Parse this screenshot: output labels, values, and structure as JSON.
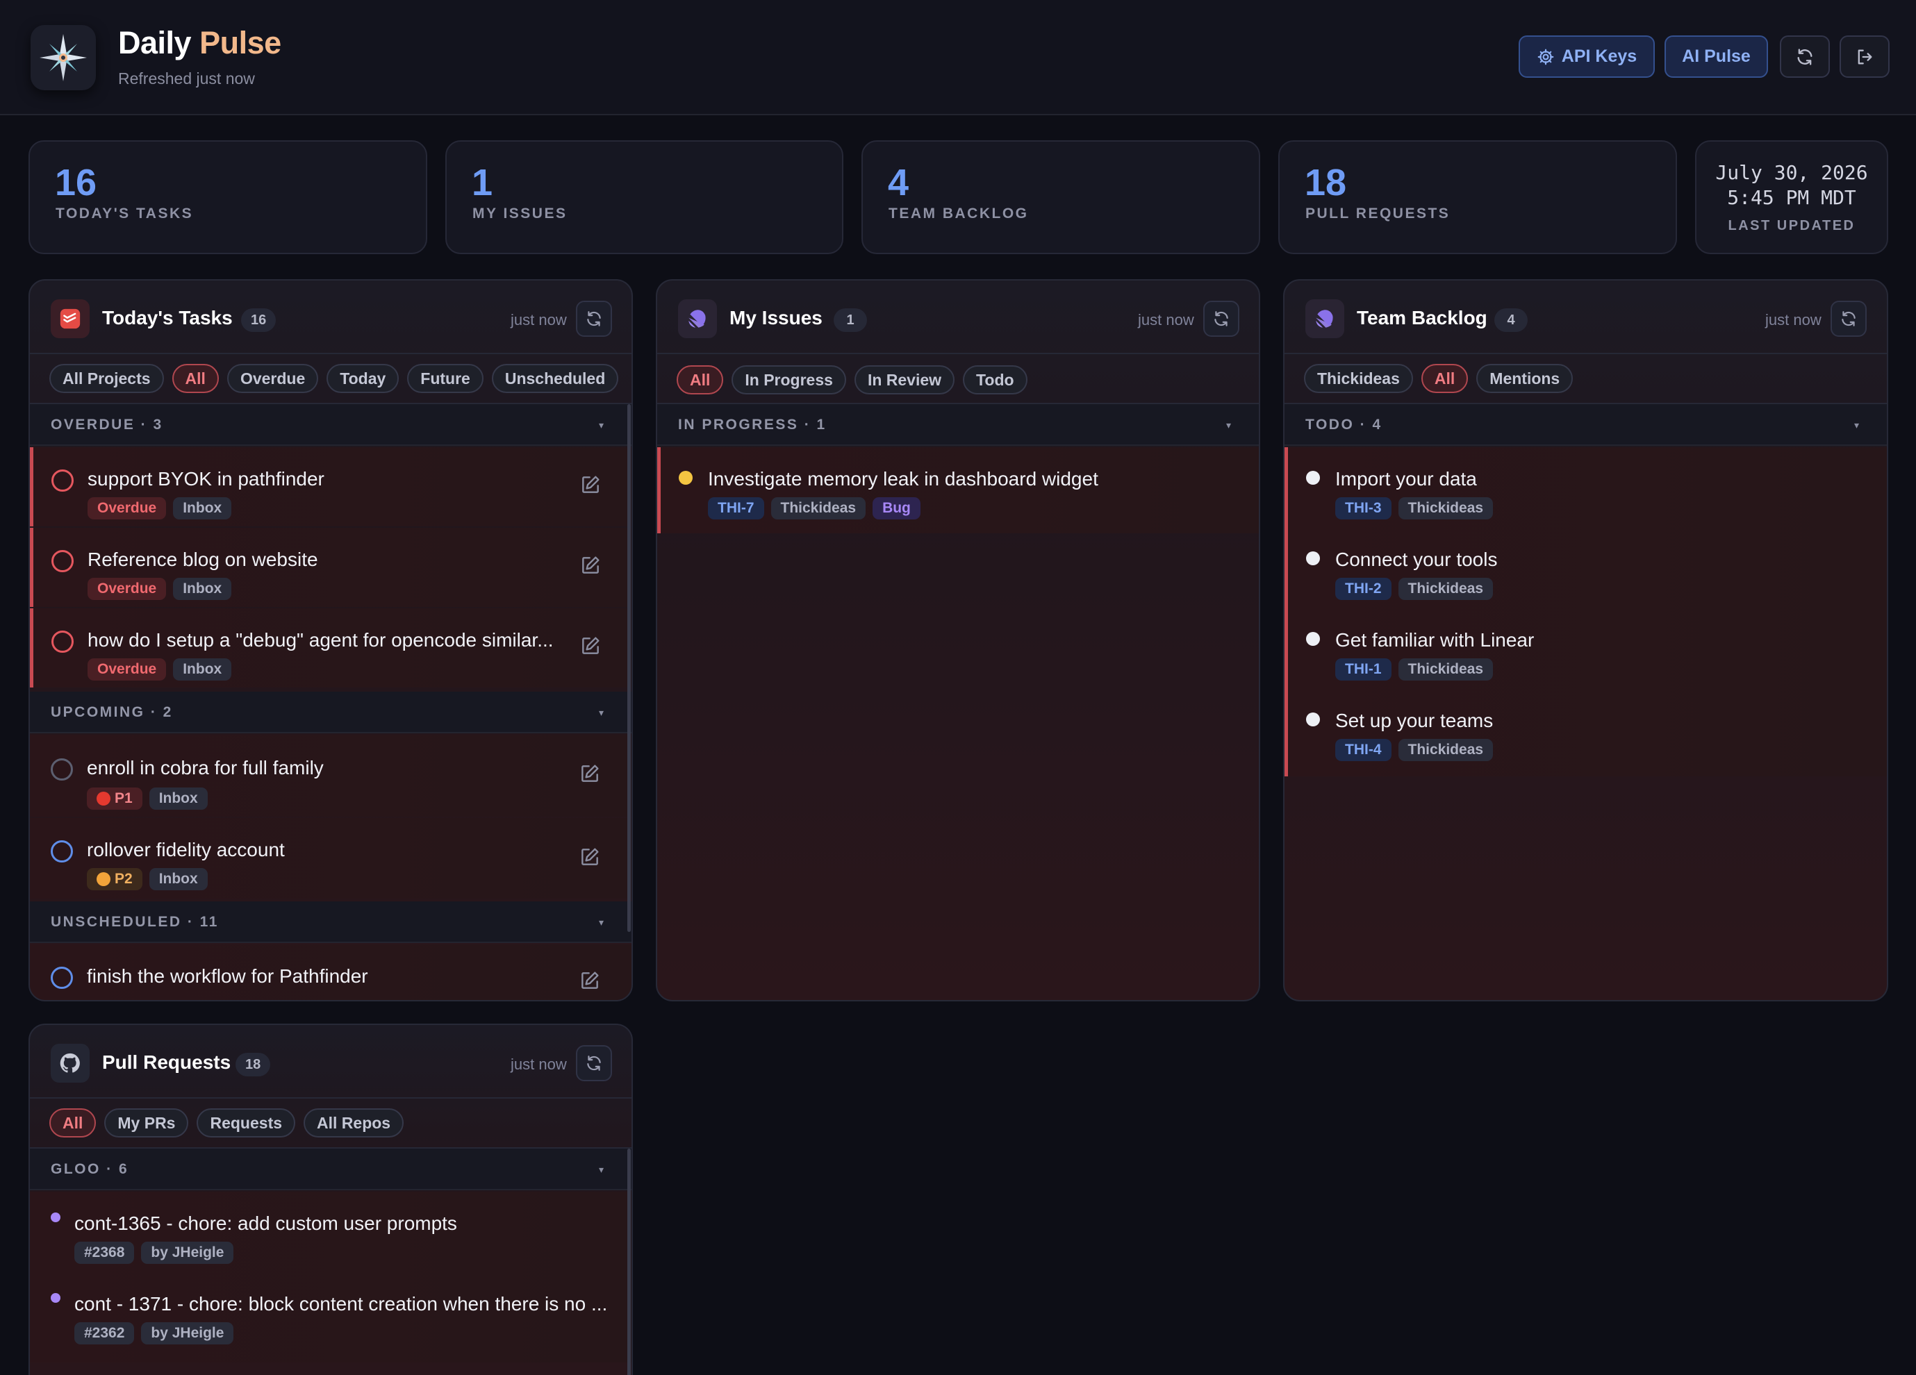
{
  "app": {
    "title_part1": "Daily",
    "title_part2": "Pulse",
    "subtitle": "Refreshed just now"
  },
  "header_buttons": {
    "api_keys": "API Keys",
    "ai_pulse": "AI Pulse"
  },
  "stats": [
    {
      "value": "16",
      "label": "TODAY'S TASKS"
    },
    {
      "value": "1",
      "label": "MY ISSUES"
    },
    {
      "value": "4",
      "label": "TEAM BACKLOG"
    },
    {
      "value": "18",
      "label": "PULL REQUESTS"
    }
  ],
  "last_updated": {
    "date": "July 30, 2026",
    "time": "5:45 PM MDT",
    "label": "LAST UPDATED"
  },
  "tasks": {
    "title": "Today's Tasks",
    "count": "16",
    "time": "just now",
    "filters": [
      "All Projects",
      "All",
      "Overdue",
      "Today",
      "Future",
      "Unscheduled"
    ],
    "active_filter": "All",
    "sections": {
      "overdue": "OVERDUE · 3",
      "upcoming": "UPCOMING · 2",
      "unscheduled": "UNSCHEDULED · 11"
    },
    "items": [
      {
        "title": "support BYOK in pathfinder",
        "tags": [
          "Overdue",
          "Inbox"
        ]
      },
      {
        "title": "Reference blog on website",
        "tags": [
          "Overdue",
          "Inbox"
        ]
      },
      {
        "title": "how do I setup a \"debug\" agent for opencode similar...",
        "tags": [
          "Overdue",
          "Inbox"
        ]
      },
      {
        "title": "enroll in cobra for full family",
        "tags": [
          "P1",
          "Inbox"
        ]
      },
      {
        "title": "rollover fidelity account",
        "tags": [
          "P2",
          "Inbox"
        ]
      },
      {
        "title": "finish the workflow for Pathfinder",
        "tags": []
      }
    ]
  },
  "issues": {
    "title": "My Issues",
    "count": "1",
    "time": "just now",
    "filters": [
      "All",
      "In Progress",
      "In Review",
      "Todo"
    ],
    "active_filter": "All",
    "section": "IN PROGRESS · 1",
    "items": [
      {
        "title": "Investigate memory leak in dashboard widget",
        "key": "THI-7",
        "team": "Thickideas",
        "label": "Bug"
      }
    ]
  },
  "backlog": {
    "title": "Team Backlog",
    "count": "4",
    "time": "just now",
    "filters": [
      "Thickideas",
      "All",
      "Mentions"
    ],
    "active_filter": "All",
    "section": "TODO · 4",
    "items": [
      {
        "title": "Import your data",
        "key": "THI-3",
        "team": "Thickideas"
      },
      {
        "title": "Connect your tools",
        "key": "THI-2",
        "team": "Thickideas"
      },
      {
        "title": "Get familiar with Linear",
        "key": "THI-1",
        "team": "Thickideas"
      },
      {
        "title": "Set up your teams",
        "key": "THI-4",
        "team": "Thickideas"
      }
    ]
  },
  "prs": {
    "title": "Pull Requests",
    "count": "18",
    "time": "just now",
    "filters": [
      "All",
      "My PRs",
      "Requests",
      "All Repos"
    ],
    "active_filter": "All",
    "section": "GLOO · 6",
    "items": [
      {
        "title": "cont-1365 - chore: add custom user prompts",
        "number": "#2368",
        "author": "by JHeigle"
      },
      {
        "title": "cont - 1371 - chore: block content creation when there is no ...",
        "number": "#2362",
        "author": "by JHeigle"
      }
    ]
  },
  "colors": {
    "accent_blue": "#6f9cf5",
    "overdue_red": "#f0696f",
    "brand_peach": "#f2b88b",
    "issue_yellow": "#f4c542",
    "pr_purple": "#a888f7"
  }
}
